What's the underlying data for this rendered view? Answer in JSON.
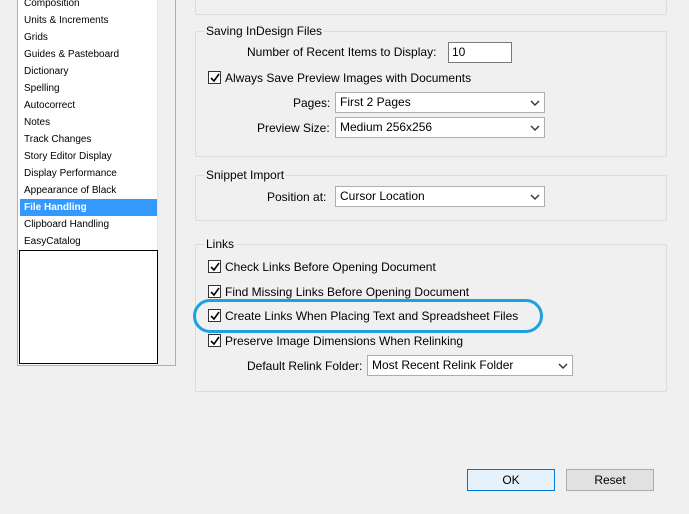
{
  "categories": [
    {
      "label": "Composition",
      "selected": false
    },
    {
      "label": "Units & Increments",
      "selected": false
    },
    {
      "label": "Grids",
      "selected": false
    },
    {
      "label": "Guides & Pasteboard",
      "selected": false
    },
    {
      "label": "Dictionary",
      "selected": false
    },
    {
      "label": "Spelling",
      "selected": false
    },
    {
      "label": "Autocorrect",
      "selected": false
    },
    {
      "label": "Notes",
      "selected": false
    },
    {
      "label": "Track Changes",
      "selected": false
    },
    {
      "label": "Story Editor Display",
      "selected": false
    },
    {
      "label": "Display Performance",
      "selected": false
    },
    {
      "label": "Appearance of Black",
      "selected": false
    },
    {
      "label": "File Handling",
      "selected": true
    },
    {
      "label": "Clipboard Handling",
      "selected": false
    },
    {
      "label": "EasyCatalog",
      "selected": false
    }
  ],
  "saving": {
    "title": "Saving InDesign Files",
    "recent_items_label": "Number of Recent Items to Display:",
    "recent_items_value": "10",
    "always_save_preview_label": "Always Save Preview Images with Documents",
    "always_save_preview_checked": true,
    "pages_label": "Pages:",
    "pages_value": "First 2 Pages",
    "preview_size_label": "Preview Size:",
    "preview_size_value": "Medium 256x256"
  },
  "snippet": {
    "title": "Snippet Import",
    "position_label": "Position at:",
    "position_value": "Cursor Location"
  },
  "links": {
    "title": "Links",
    "check_links_label": "Check Links Before Opening Document",
    "check_links_checked": true,
    "find_missing_label": "Find Missing Links Before Opening Document",
    "find_missing_checked": true,
    "create_links_label": "Create Links When Placing Text and Spreadsheet Files",
    "create_links_checked": true,
    "preserve_dims_label": "Preserve Image Dimensions When Relinking",
    "preserve_dims_checked": true,
    "relink_folder_label": "Default Relink Folder:",
    "relink_folder_value": "Most Recent Relink Folder"
  },
  "buttons": {
    "ok": "OK",
    "reset": "Reset"
  },
  "colors": {
    "selection": "#3399ff",
    "highlight_ring": "#1ba1e2",
    "default_button_border": "#0078d7"
  },
  "icons": {
    "checkmark": "checkmark-icon",
    "dropdown": "chevron-down-icon"
  }
}
